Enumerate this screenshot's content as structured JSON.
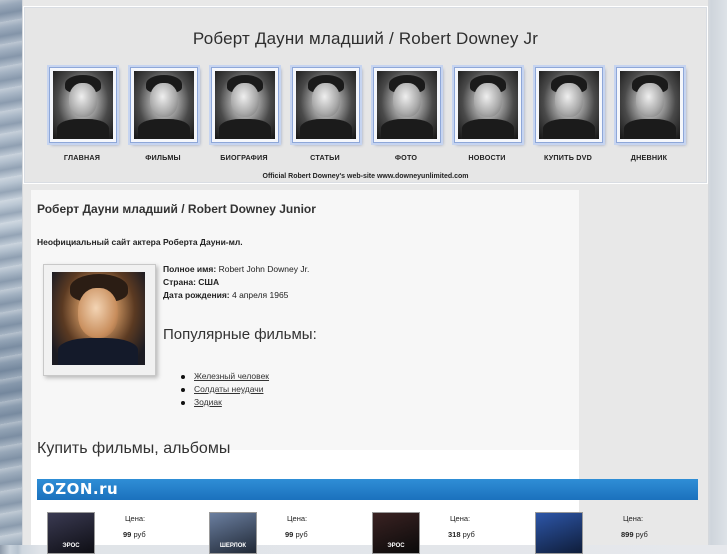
{
  "site": {
    "title": "Роберт Дауни младший / Robert Downey Jr",
    "official": "Official Robert Downey's web-site www.downeyunlimited.com"
  },
  "nav": [
    {
      "label": "ГЛАВНАЯ"
    },
    {
      "label": "ФИЛЬМЫ"
    },
    {
      "label": "БИОГРАФИЯ"
    },
    {
      "label": "СТАТЬИ"
    },
    {
      "label": "ФОТО"
    },
    {
      "label": "НОВОСТИ"
    },
    {
      "label": "КУПИТЬ DVD"
    },
    {
      "label": "ДНЕВНИК"
    }
  ],
  "main": {
    "heading": "Роберт Дауни младший / Robert Downey Junior",
    "subheading": "Неофициальный сайт актера Роберта Дауни-мл.",
    "info": {
      "fullname_label": "Полное имя:",
      "fullname_value": "Robert John Downey Jr.",
      "country_label": "Страна:",
      "country_value": "США",
      "birth_label": "Дата рождения:",
      "birth_value": "4 апреля 1965"
    },
    "popular_title": "Популярные фильмы:",
    "films": [
      "Железный человек",
      "Солдаты неудачи",
      "Зодиак"
    ],
    "buy_title": "Купить фильмы, альбомы",
    "ozon_logo": "OZON.ru"
  },
  "products": [
    {
      "image_text": "ЭРОС",
      "price_label": "Цена:",
      "price": "99",
      "currency": "руб"
    },
    {
      "image_text": "ШЕРЛОК",
      "price_label": "Цена:",
      "price": "99",
      "currency": "руб"
    },
    {
      "image_text": "ЭРОС",
      "price_label": "Цена:",
      "price": "318",
      "currency": "руб"
    },
    {
      "image_text": "",
      "price_label": "Цена:",
      "price": "899",
      "currency": "руб"
    }
  ]
}
